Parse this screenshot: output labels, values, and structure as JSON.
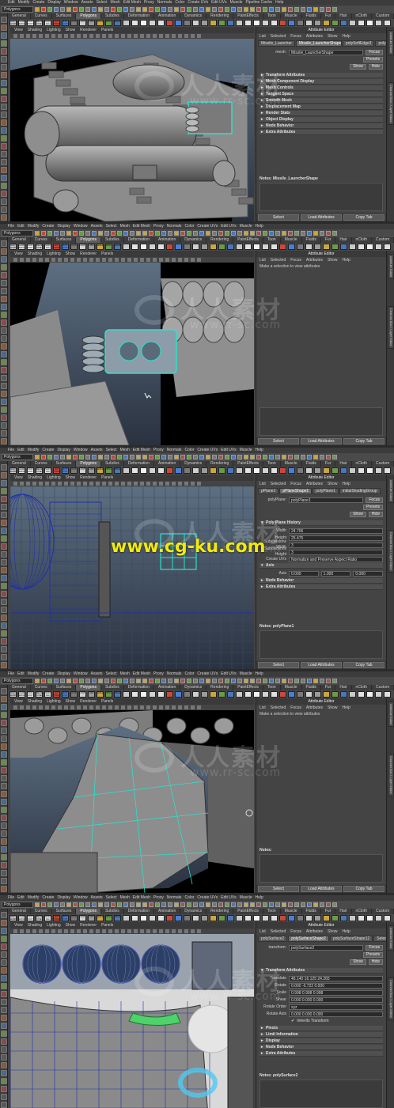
{
  "menus": {
    "main": [
      "Edit",
      "Modify",
      "Create",
      "Display",
      "Window",
      "Assets",
      "Select",
      "Mesh",
      "Edit Mesh",
      "Proxy",
      "Normals",
      "Color",
      "Create UVs",
      "Edit UVs",
      "Muscle",
      "Pipeline Cache",
      "Help"
    ],
    "main_alt": [
      "File",
      "Edit",
      "Modify",
      "Create",
      "Display",
      "Window",
      "Assets",
      "Select",
      "Mesh",
      "Edit Mesh",
      "Proxy",
      "Normals",
      "Color",
      "Create UVs",
      "Edit UVs",
      "Muscle",
      "Help"
    ],
    "mode": "Polygons",
    "shelf_tabs": [
      "General",
      "Curves",
      "Surfaces",
      "Polygons",
      "Subdivs",
      "Deformation",
      "Animation",
      "Dynamics",
      "Rendering",
      "PaintEffects",
      "Toon",
      "Muscle",
      "Fluids",
      "Fur",
      "Hair",
      "nCloth",
      "Custom",
      "SGM"
    ],
    "viewport_menu": [
      "View",
      "Shading",
      "Lighting",
      "Show",
      "Renderer",
      "Panels"
    ],
    "attr_menu": [
      "List",
      "Selected",
      "Focus",
      "Attributes",
      "Show",
      "Help"
    ],
    "attr_title": "Attribute Editor",
    "shelf_icons": [
      "SOFT HARD",
      "HARD EDGE",
      "SMOOTH SOFT",
      "BEVEL ONE",
      "SOFT ALL",
      "EX TRUDE",
      "EXT CUT",
      "CUT",
      "ONT",
      "UTE",
      "HOLE",
      "SPLIT",
      "FACE"
    ]
  },
  "panels": [
    {
      "tabs": [
        "Missile_Launcher",
        "Missile_LauncherShape",
        "polySoftEdge3",
        "poly"
      ],
      "field_label": "mesh:",
      "field_value": "Missile_LauncherShape",
      "buttons": [
        "Focus",
        "Presets",
        "Show",
        "Hide"
      ],
      "sections": [
        "Transform Attributes",
        "Mesh Component Display",
        "Mesh Controls",
        "Tangent Space",
        "Smooth Mesh",
        "Displacement Map",
        "Render Stats",
        "Object Display",
        "Node Behavior",
        "Extra Attributes"
      ],
      "notes": "Notes: Missile_LauncherShape",
      "bottom": [
        "Select",
        "Load Attributes",
        "Copy Tab"
      ],
      "watermark_cn": "人人素材",
      "watermark_url": "www.rr-sc.com"
    },
    {
      "message": "Make a selection to view attributes",
      "bottom": [
        "Select",
        "Load Attributes",
        "Copy Tab"
      ],
      "watermark_cn": "人人素材",
      "watermark_url": "www.rr-sc.com"
    },
    {
      "tabs": [
        "pPlane1",
        "pPlaneShape1",
        "polyPlane1",
        "initialShadingGroup"
      ],
      "field_label": "polyPlane:",
      "field_value": "polyPlane1",
      "buttons": [
        "Focus",
        "Presets",
        "Show",
        "Hide"
      ],
      "open_section": "Poly Plane History",
      "rows": [
        {
          "label": "Width",
          "value": "24.706"
        },
        {
          "label": "Height",
          "value": "25.475"
        },
        {
          "label": "Subdivisions Width",
          "value": "3"
        },
        {
          "label": "Subdivisions Height",
          "value": "3"
        },
        {
          "label": "Create UVs",
          "value": "Normalize and Preserve Aspect Ratio"
        }
      ],
      "axis_section": "Axis",
      "axis": [
        "0.000",
        "1.000",
        "0.000"
      ],
      "axis_label": "Axis",
      "sections": [
        "Node Behavior",
        "Extra Attributes"
      ],
      "notes": "Notes: polyPlane1",
      "bottom": [
        "Select",
        "Load Attributes",
        "Copy Tab"
      ],
      "watermark_cn": "人人素材",
      "watermark_url": "www.rr-sc.com",
      "watermark_yellow": "www.cg-ku.com"
    },
    {
      "message": "Make a selection to view attributes",
      "notes": "Notes:",
      "bottom": [
        "Select",
        "Load Attributes",
        "Copy Tab"
      ],
      "watermark_cn": "人人素材",
      "watermark_url": "www.rr-sc.com"
    },
    {
      "tabs": [
        "polySurface2",
        "polySurfaceShape2",
        "polySurfaceShape12",
        "Select"
      ],
      "field_label": "transform:",
      "field_value": "polySurface2",
      "buttons": [
        "Focus",
        "Presets",
        "Show",
        "Hide"
      ],
      "open_section": "Transform Attributes",
      "rows": [
        {
          "label": "Translate",
          "value": "46.140   16.125   24.265"
        },
        {
          "label": "Rotate",
          "value": "0.000   -0.722   0.000"
        },
        {
          "label": "Scale",
          "value": "0.998   0.998   0.998"
        },
        {
          "label": "Shear",
          "value": "0.000   0.000   0.000"
        },
        {
          "label": "Rotate Order",
          "value": "xyz"
        },
        {
          "label": "Rotate Axis",
          "value": "0.000   0.000   0.000"
        }
      ],
      "checkbox": "Inherits Transform",
      "sections": [
        "Pivots",
        "Limit Information",
        "Display",
        "Node Behavior",
        "Extra Attributes"
      ],
      "notes": "Notes: polySurface2",
      "bottom": [
        "Select",
        "Load Attributes",
        "Copy Tab"
      ],
      "watermark_cn": "人人素材",
      "watermark_url": "www.rr-sc.com"
    }
  ],
  "side_tabs": [
    "Attribute Editor",
    "Channel Box / Layer Editor"
  ],
  "colors": {
    "maya_bg": "#444444",
    "viewport_grad_top": "#5d6f82",
    "viewport_grad_bottom": "#2a3240",
    "wire_blue": "#2230a8",
    "highlight_cyan": "#2ee0c9",
    "watermark_yellow": "#f2e90c"
  }
}
